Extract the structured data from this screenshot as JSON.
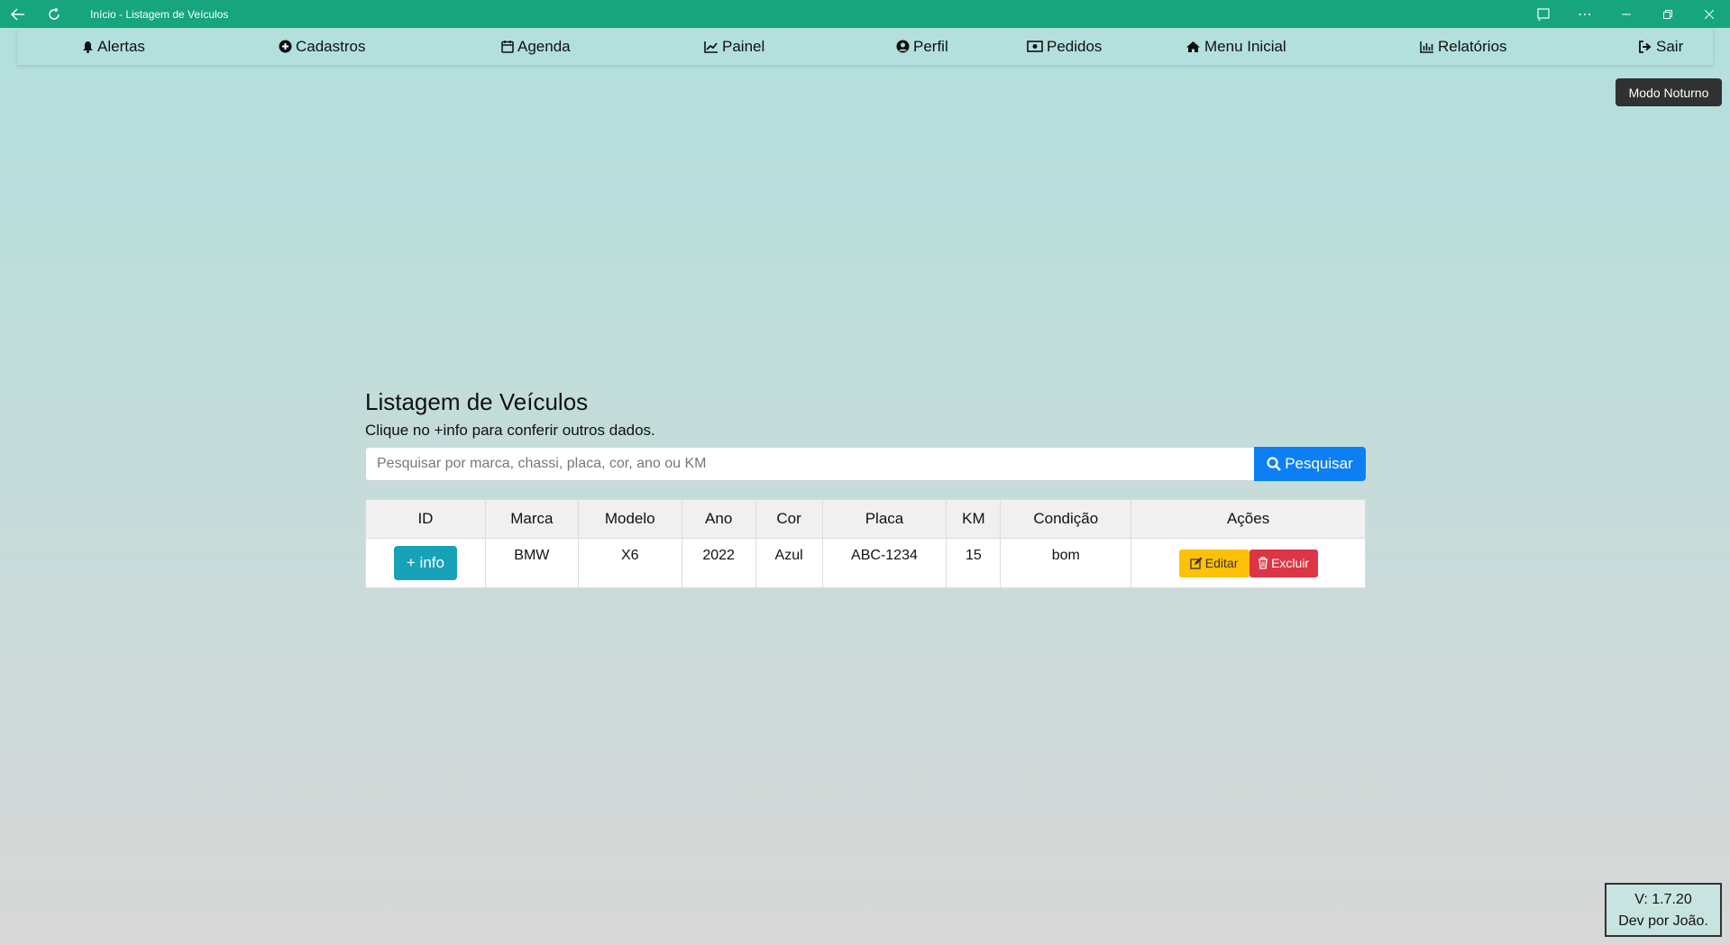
{
  "window": {
    "title": "Início - Listagem de Veículos"
  },
  "nav": {
    "items": [
      {
        "label": "Alertas",
        "icon": "bell-icon"
      },
      {
        "label": "Cadastros",
        "icon": "plus-circle-icon"
      },
      {
        "label": "Agenda",
        "icon": "calendar-icon"
      },
      {
        "label": "Painel",
        "icon": "chart-line-icon"
      },
      {
        "label": "Perfil",
        "icon": "user-circle-icon"
      },
      {
        "label": "Pedidos",
        "icon": "money-bill-icon"
      },
      {
        "label": "Menu Inicial",
        "icon": "home-icon"
      },
      {
        "label": "Relatórios",
        "icon": "bar-chart-icon"
      },
      {
        "label": "Sair",
        "icon": "sign-out-icon"
      }
    ]
  },
  "night_mode_label": "Modo Noturno",
  "main": {
    "title": "Listagem de Veículos",
    "subtitle": "Clique no +info para conferir outros dados.",
    "search": {
      "placeholder": "Pesquisar por marca, chassi, placa, cor, ano ou KM",
      "value": "",
      "button_label": "Pesquisar"
    },
    "table": {
      "headers": [
        "ID",
        "Marca",
        "Modelo",
        "Ano",
        "Cor",
        "Placa",
        "KM",
        "Condição",
        "Ações"
      ],
      "rows": [
        {
          "info_label": "+ info",
          "marca": "BMW",
          "modelo": "X6",
          "ano": "2022",
          "cor": "Azul",
          "placa": "ABC-1234",
          "km": "15",
          "condicao": "bom",
          "edit_label": "Editar",
          "delete_label": "Excluir"
        }
      ]
    }
  },
  "footer": {
    "version": "V: 1.7.20",
    "dev": "Dev por João."
  },
  "colors": {
    "titlebar": "#16a57c",
    "primary": "#0d7ff5",
    "info": "#17a2b8",
    "warning": "#ffc107",
    "danger": "#dc3545"
  }
}
